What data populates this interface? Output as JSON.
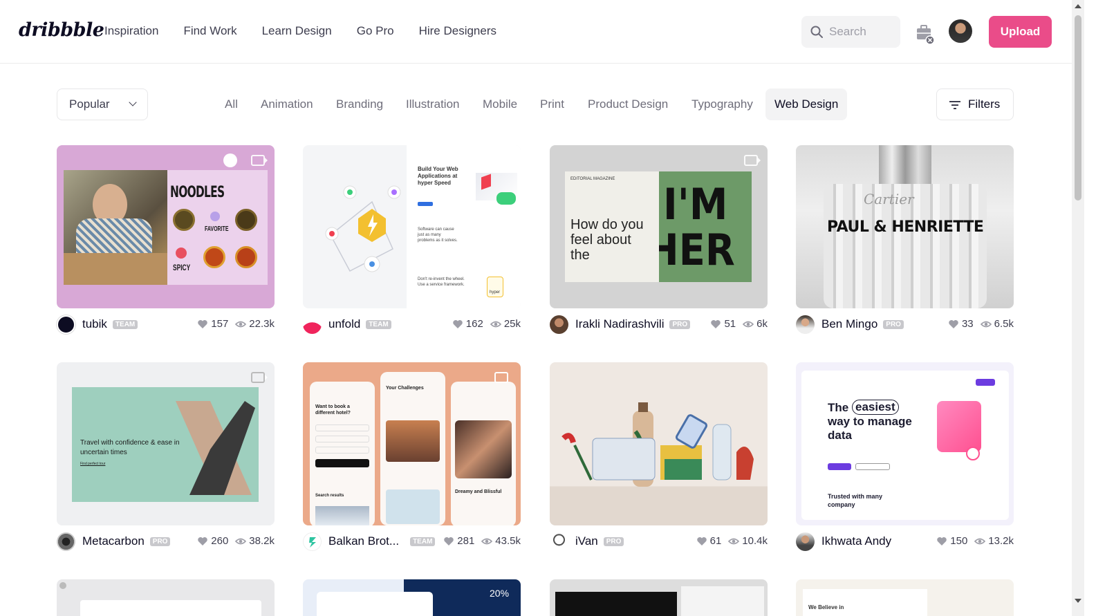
{
  "header": {
    "logo": "dribbble",
    "nav": [
      "Inspiration",
      "Find Work",
      "Learn Design",
      "Go Pro",
      "Hire Designers"
    ],
    "search_placeholder": "Search",
    "upload_label": "Upload"
  },
  "filterbar": {
    "sort_label": "Popular",
    "categories": [
      "All",
      "Animation",
      "Branding",
      "Illustration",
      "Mobile",
      "Print",
      "Product Design",
      "Typography",
      "Web Design"
    ],
    "active_category": "Web Design",
    "filters_label": "Filters"
  },
  "shots": [
    {
      "name": "tubik",
      "badge": "TEAM",
      "likes": "157",
      "views": "22.3k",
      "art": {
        "title": "NOODLES",
        "label": "FAVORITE",
        "label2": "SPICY"
      }
    },
    {
      "name": "unfold",
      "badge": "TEAM",
      "likes": "162",
      "views": "25k",
      "art": {
        "headline": "Build Your Web Applications at hyper Speed",
        "sub": "Software can cause just as many problems as it solves.",
        "sub2": "Don't re-invent the wheel. Use a service framework.",
        "chip": "hyper"
      }
    },
    {
      "name": "Irakli Nadirashvili",
      "badge": "PRO",
      "likes": "51",
      "views": "6k",
      "art": {
        "small": "EDITORIAL MAGAZINE",
        "headline": "How do you feel about the",
        "big1": "I'M",
        "big2": "HER"
      }
    },
    {
      "name": "Ben Mingo",
      "badge": "PRO",
      "likes": "33",
      "views": "6.5k",
      "art": {
        "brand": "Cartier",
        "title": "PAUL & HENRIETTE"
      }
    },
    {
      "name": "Metacarbon",
      "badge": "PRO",
      "likes": "260",
      "views": "38.2k",
      "art": {
        "headline": "Travel with confidence & ease in uncertain times",
        "link": "Find perfect tour"
      }
    },
    {
      "name": "Balkan Brot...",
      "badge": "TEAM",
      "likes": "281",
      "views": "43.5k",
      "art": {
        "p1": "Want to book a different hotel?",
        "p2": "Your Challenges",
        "p3": "Dreamy and Blissful",
        "p4": "Search results"
      }
    },
    {
      "name": "iVan",
      "badge": "PRO",
      "likes": "61",
      "views": "10.4k",
      "art": {}
    },
    {
      "name": "Ikhwata Andy",
      "badge": "",
      "likes": "150",
      "views": "13.2k",
      "art": {
        "h1": "The",
        "h2": "easiest",
        "h3": "way to manage",
        "h4": "data",
        "trusted": "Trusted with many company"
      }
    }
  ],
  "peek": {
    "percent": "20%",
    "title": "We Believe in"
  },
  "colors": {
    "brand_pink": "#ea4c89",
    "text": "#0d0c22",
    "muted": "#6e6d7a"
  }
}
